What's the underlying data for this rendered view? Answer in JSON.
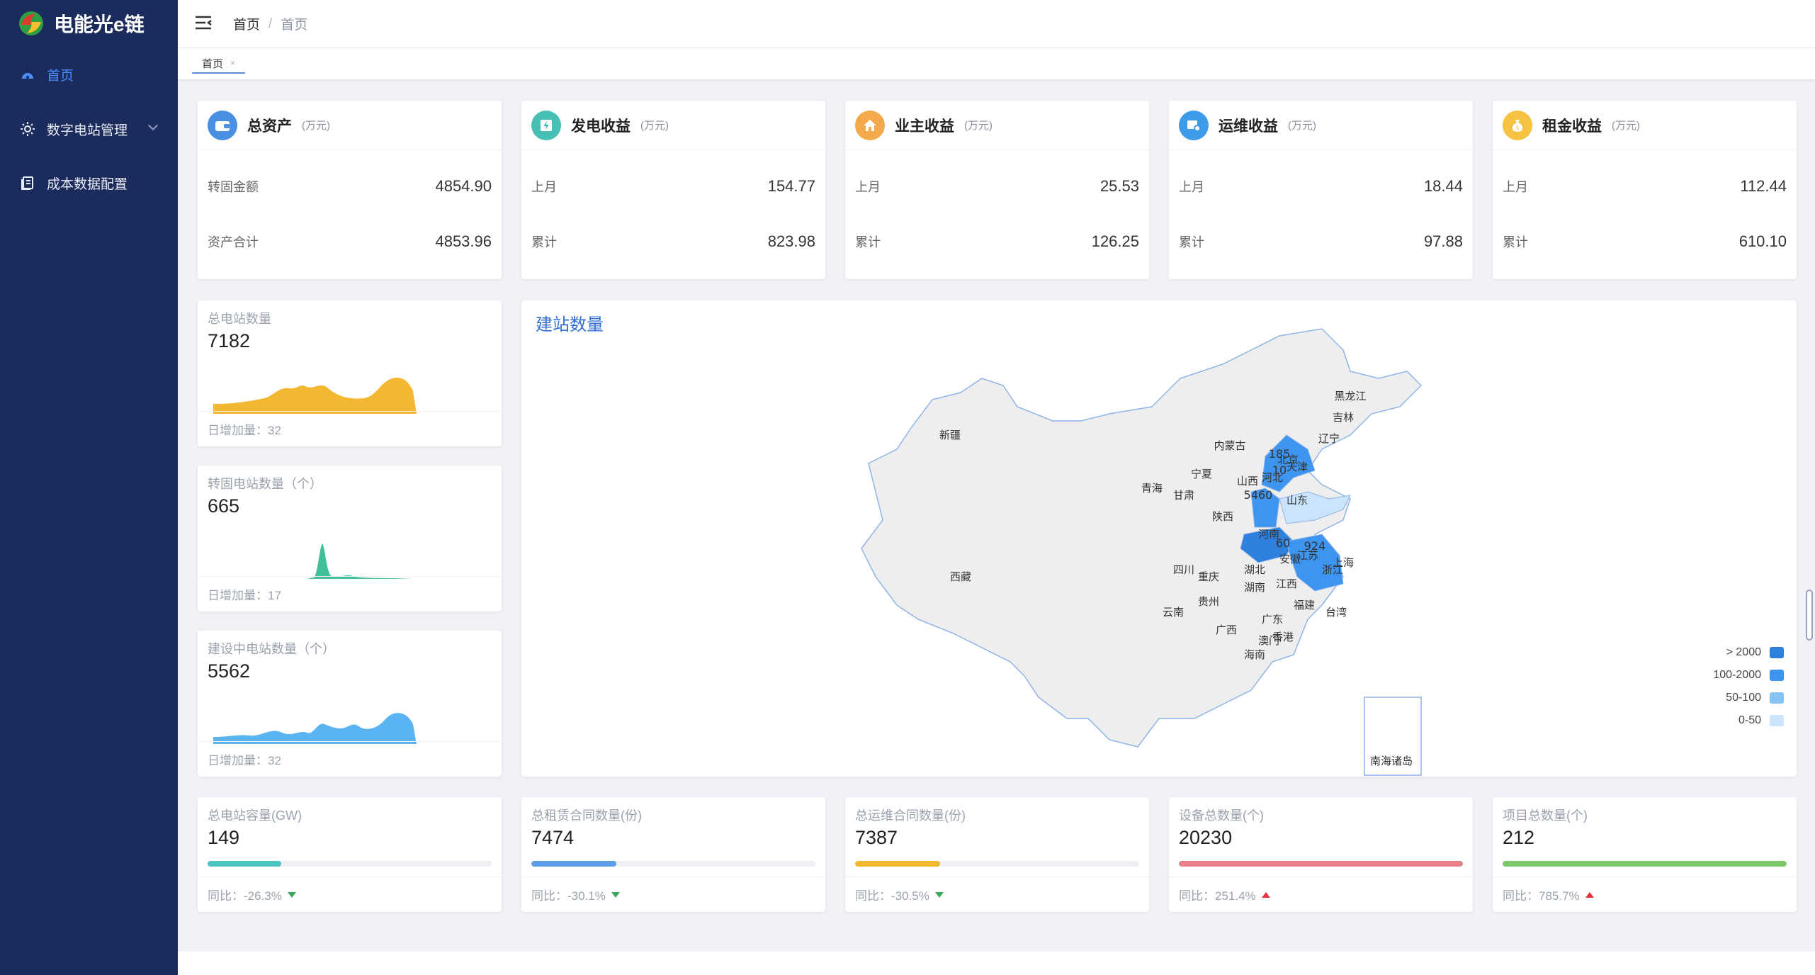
{
  "app": {
    "title": "电能光e链"
  },
  "sidebar": {
    "items": [
      {
        "label": "首页",
        "icon": "dashboard-icon",
        "active": true
      },
      {
        "label": "数字电站管理",
        "icon": "sun-icon",
        "active": false
      },
      {
        "label": "成本数据配置",
        "icon": "document-icon",
        "active": false
      }
    ]
  },
  "header": {
    "breadcrumb": [
      "首页",
      "首页"
    ],
    "tabs": [
      {
        "label": "首页",
        "close": "×"
      }
    ]
  },
  "kpi_cards": [
    {
      "title": "总资产",
      "unit": "(万元)",
      "icon": "wallet-icon",
      "color": "#4a90e2",
      "rows": [
        {
          "label": "转固金额",
          "value": "4854.90"
        },
        {
          "label": "资产合计",
          "value": "4853.96"
        }
      ]
    },
    {
      "title": "发电收益",
      "unit": "(万元)",
      "icon": "power-icon",
      "color": "#46c0b4",
      "rows": [
        {
          "label": "上月",
          "value": "154.77"
        },
        {
          "label": "累计",
          "value": "823.98"
        }
      ]
    },
    {
      "title": "业主收益",
      "unit": "(万元)",
      "icon": "home-icon",
      "color": "#f4a94a",
      "rows": [
        {
          "label": "上月",
          "value": "25.53"
        },
        {
          "label": "累计",
          "value": "126.25"
        }
      ]
    },
    {
      "title": "运维收益",
      "unit": "(万元)",
      "icon": "maintenance-icon",
      "color": "#3d9be9",
      "rows": [
        {
          "label": "上月",
          "value": "18.44"
        },
        {
          "label": "累计",
          "value": "97.88"
        }
      ]
    },
    {
      "title": "租金收益",
      "unit": "(万元)",
      "icon": "money-bag-icon",
      "color": "#f5c242",
      "rows": [
        {
          "label": "上月",
          "value": "112.44"
        },
        {
          "label": "累计",
          "value": "610.10"
        }
      ]
    }
  ],
  "station_cards": [
    {
      "label": "总电站数量",
      "value": "7182",
      "footer": "日增加量：32",
      "color": "#f4b731"
    },
    {
      "label": "转固电站数量（个）",
      "value": "665",
      "footer": "日增加量：17",
      "color": "#3fbf9a"
    },
    {
      "label": "建设中电站数量（个）",
      "value": "5562",
      "footer": "日增加量：32",
      "color": "#5ab4f2"
    }
  ],
  "map": {
    "title": "建站数量",
    "legend": [
      {
        "label": "> 2000",
        "color": "#2f80dd"
      },
      {
        "label": "100-2000",
        "color": "#3d95ef"
      },
      {
        "label": "50-100",
        "color": "#86c3f5"
      },
      {
        "label": "0-50",
        "color": "#c9e4fb"
      }
    ],
    "provinces": [
      "黑龙江",
      "吉林",
      "辽宁",
      "内蒙古",
      "北京",
      "河北",
      "天津",
      "山西",
      "山东",
      "宁夏",
      "青海",
      "甘肃",
      "陕西",
      "河南",
      "江苏",
      "安徽",
      "上海",
      "浙江",
      "湖北",
      "四川",
      "重庆",
      "湖南",
      "江西",
      "新疆",
      "西藏",
      "贵州",
      "云南",
      "福建",
      "台湾",
      "广东",
      "广西",
      "香港",
      "澳门",
      "海南",
      "南海诸岛"
    ],
    "values": [
      {
        "province": "北京",
        "text": "185"
      },
      {
        "province": "天津",
        "text": "10"
      },
      {
        "province": "山西",
        "text": "5460"
      },
      {
        "province": "河南",
        "text": "60"
      },
      {
        "province": "江苏",
        "text": "924"
      }
    ]
  },
  "bottom_cards": [
    {
      "label": "总电站容量(GW)",
      "value": "149",
      "footer": "同比：-26.3%",
      "trend": "down",
      "progress": 0.26,
      "color": "#4cc3c0"
    },
    {
      "label": "总租赁合同数量(份)",
      "value": "7474",
      "footer": "同比：-30.1%",
      "trend": "down",
      "progress": 0.3,
      "color": "#5d9ce6"
    },
    {
      "label": "总运维合同数量(份)",
      "value": "7387",
      "footer": "同比：-30.5%",
      "trend": "down",
      "progress": 0.3,
      "color": "#f4b731"
    },
    {
      "label": "设备总数量(个)",
      "value": "20230",
      "footer": "同比：251.4%",
      "trend": "up",
      "progress": 1.0,
      "color": "#e8808a"
    },
    {
      "label": "项目总数量(个)",
      "value": "212",
      "footer": "同比：785.7%",
      "trend": "up",
      "progress": 1.0,
      "color": "#7cc767"
    }
  ]
}
